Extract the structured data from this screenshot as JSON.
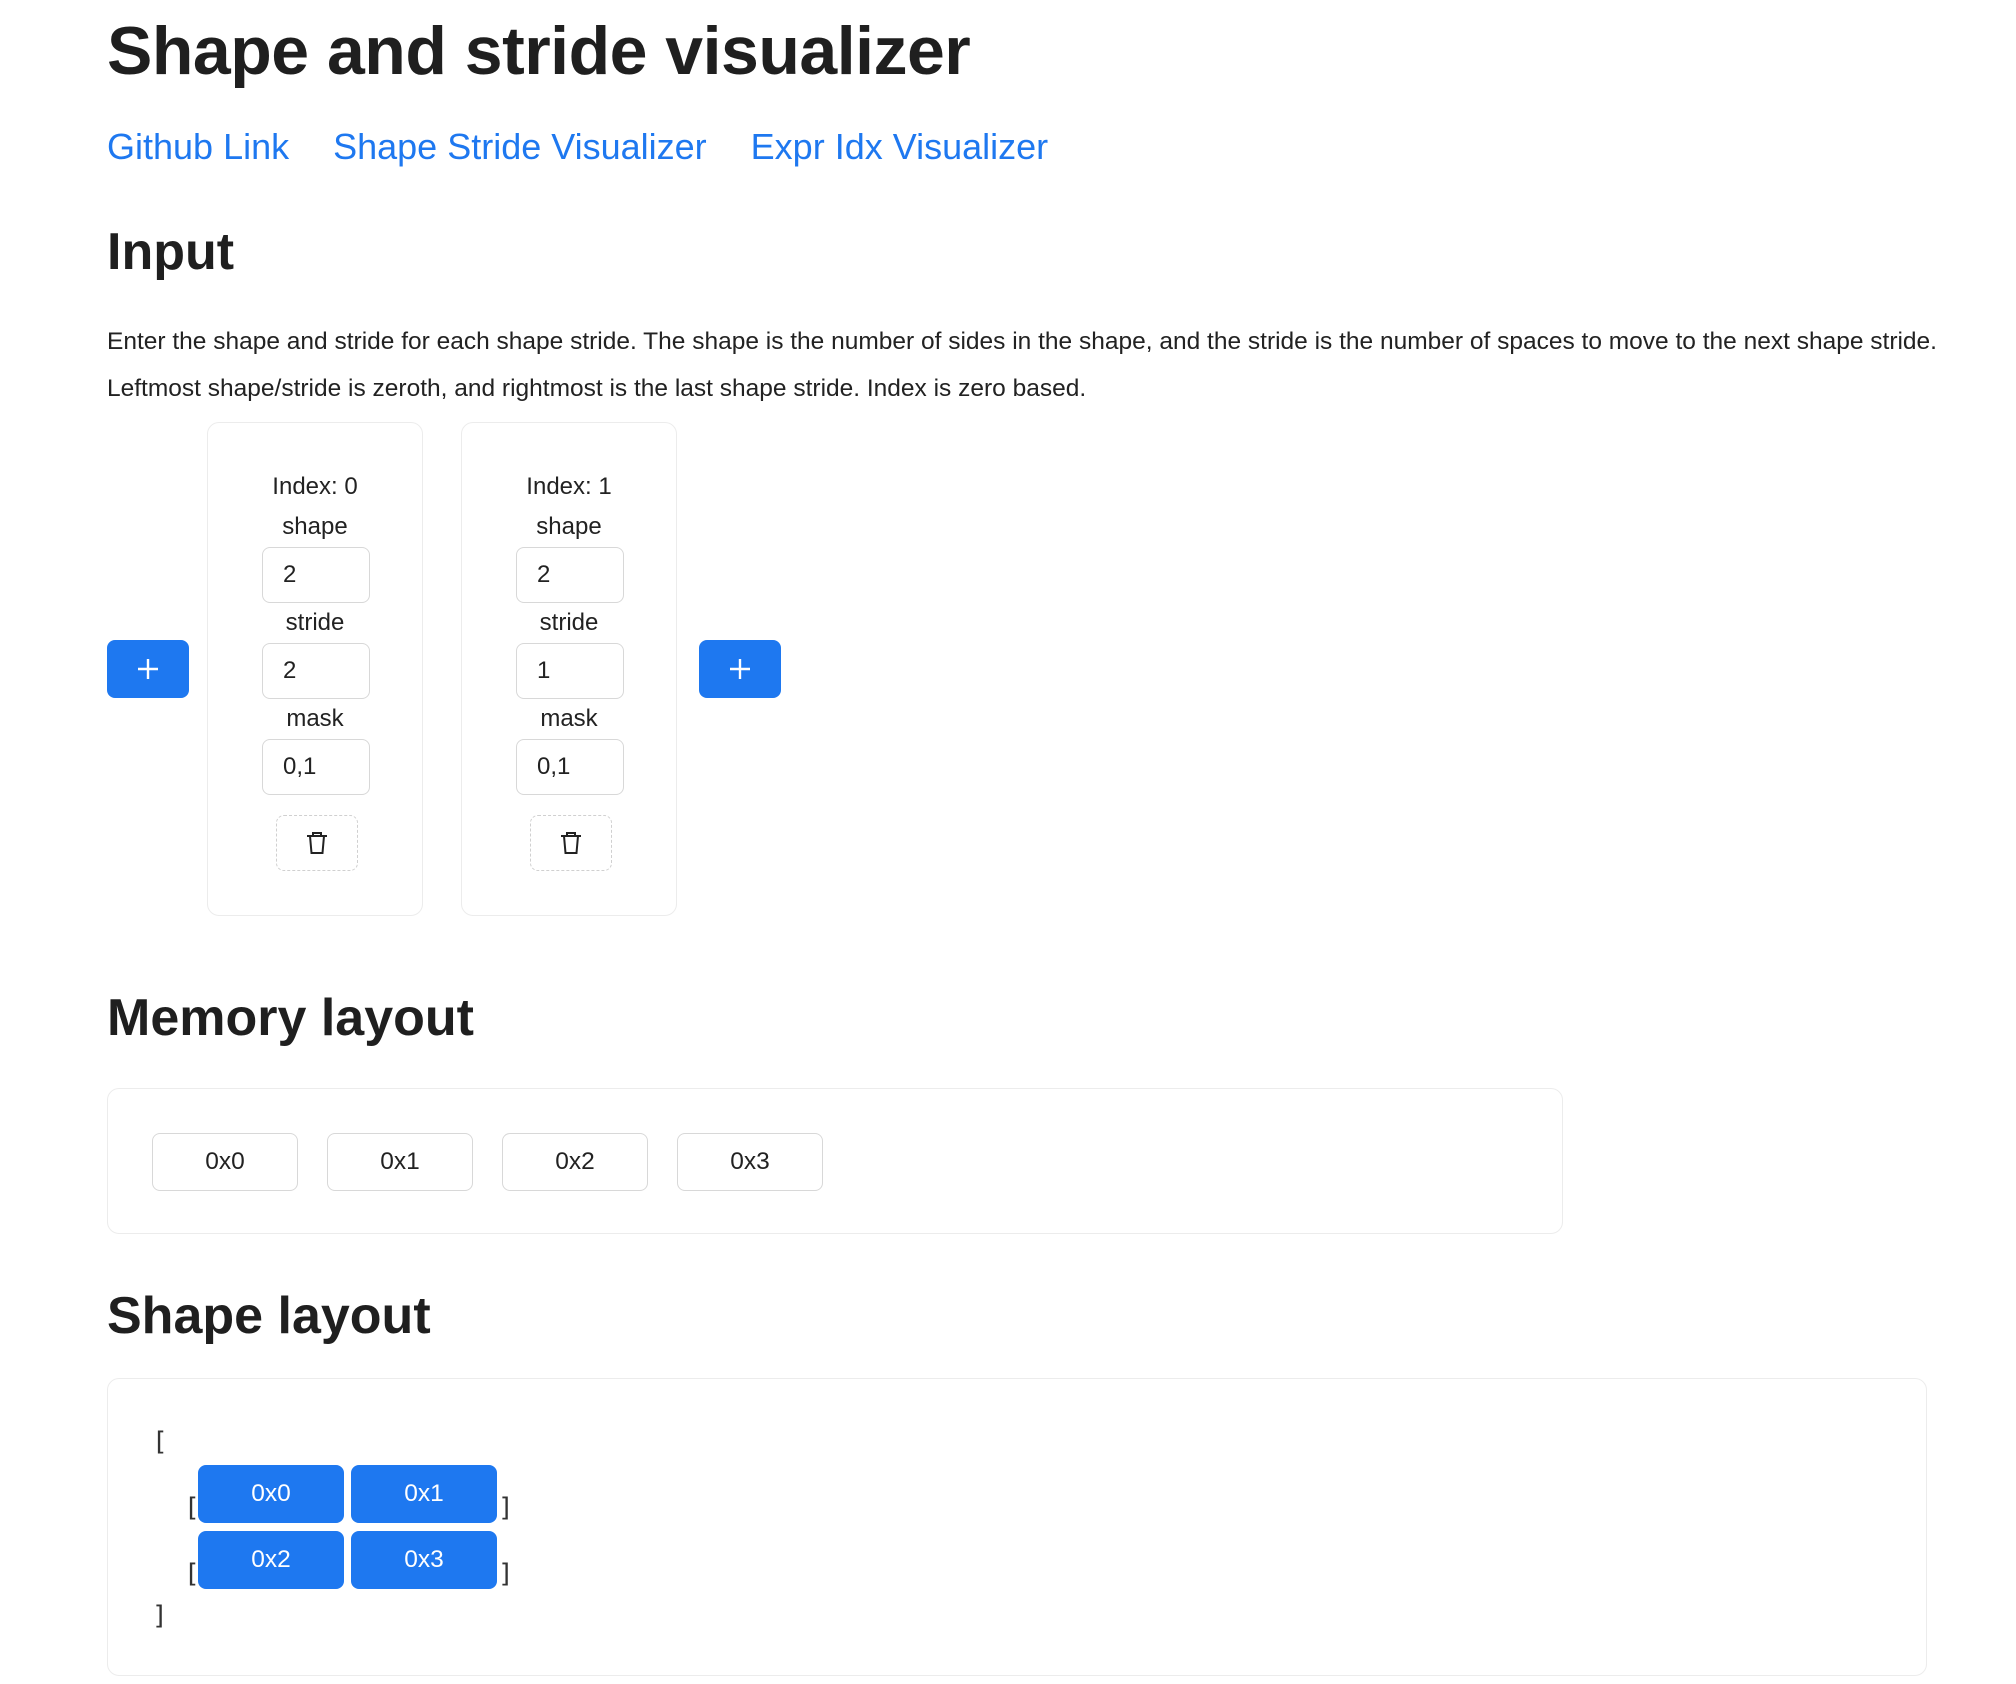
{
  "page": {
    "title": "Shape and stride visualizer"
  },
  "nav": {
    "links": [
      "Github Link",
      "Shape Stride Visualizer",
      "Expr Idx Visualizer"
    ]
  },
  "input": {
    "heading": "Input",
    "description": "Enter the shape and stride for each shape stride. The shape is the number of sides in the shape, and the stride is the number of spaces to move to the next shape stride. Leftmost shape/stride is zeroth, and rightmost is the last shape stride. Index is zero based.",
    "add_button_glyph": "+",
    "shape_label": "shape",
    "stride_label": "stride",
    "mask_label": "mask",
    "items": [
      {
        "index_label": "Index: 0",
        "shape": "2",
        "stride": "2",
        "mask": "0,1"
      },
      {
        "index_label": "Index: 1",
        "shape": "2",
        "stride": "1",
        "mask": "0,1"
      }
    ]
  },
  "memory": {
    "heading": "Memory layout",
    "cells": [
      "0x0",
      "0x1",
      "0x2",
      "0x3"
    ]
  },
  "shape_layout": {
    "heading": "Shape layout",
    "open_bracket": "[",
    "close_bracket": "]",
    "rows": [
      [
        "0x0",
        "0x1"
      ],
      [
        "0x2",
        "0x3"
      ]
    ]
  },
  "colors": {
    "accent": "#1e78f0",
    "link": "#1e78f0",
    "text": "#1f1f1f",
    "border": "#ececec"
  },
  "icons": {
    "add": "plus-icon",
    "delete": "trash-icon"
  }
}
